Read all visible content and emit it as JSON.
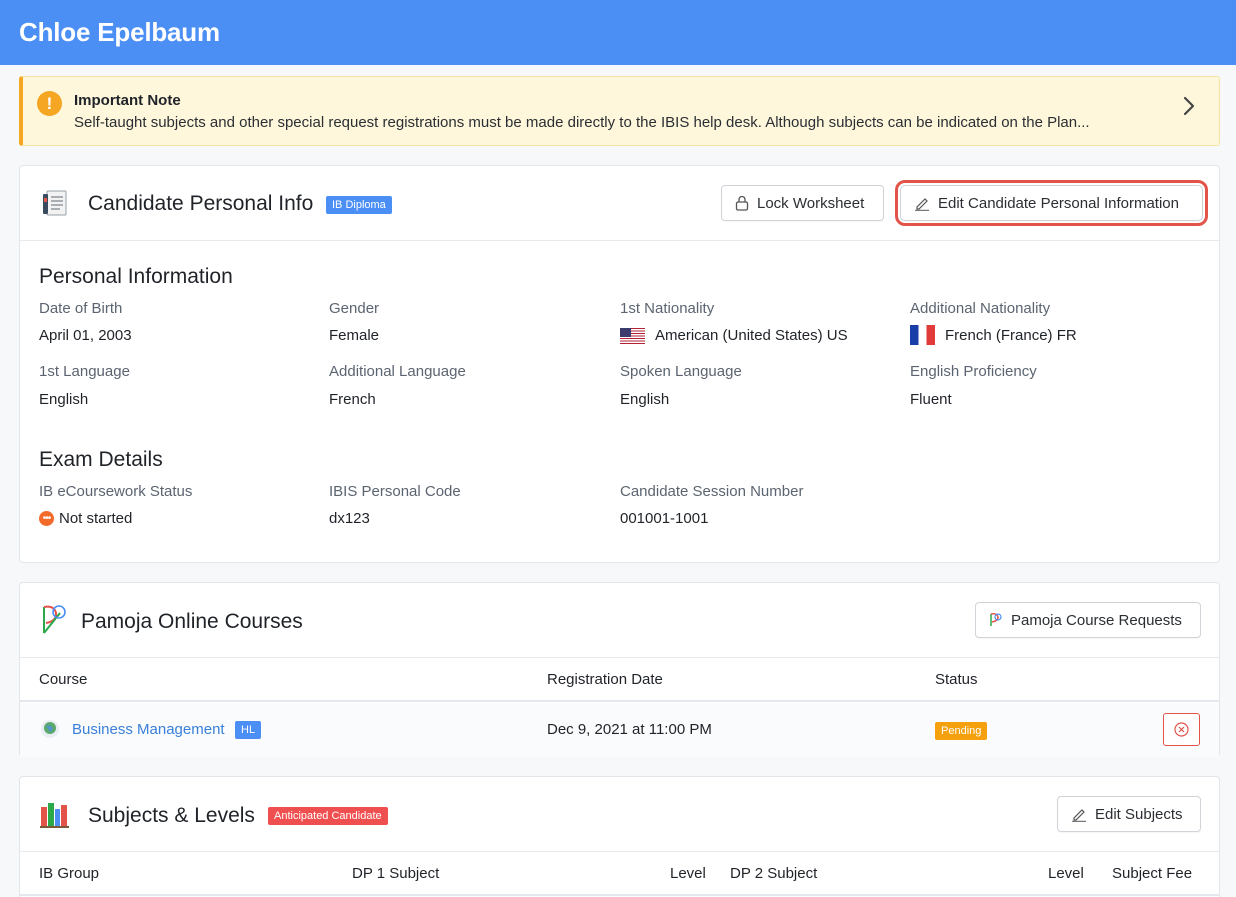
{
  "header": {
    "title": "Chloe Epelbaum"
  },
  "note": {
    "icon": "exclamation-icon",
    "icon_glyph": "!",
    "title": "Important Note",
    "body": "Self-taught subjects and other special request registrations must be made directly to the IBIS help desk. Although subjects can be indicated on the Plan..."
  },
  "personal_card": {
    "title": "Candidate Personal Info",
    "badge": "IB Diploma",
    "badge_color": "#4b8ff4",
    "lock_button": "Lock Worksheet",
    "edit_button": "Edit Candidate Personal Information",
    "personal_info": {
      "heading": "Personal Information",
      "date_of_birth": {
        "label": "Date of Birth",
        "value": "April 01, 2003"
      },
      "gender": {
        "label": "Gender",
        "value": "Female"
      },
      "first_nationality": {
        "label": "1st Nationality",
        "value": "American (United States) US",
        "flag": "us-flag-icon"
      },
      "additional_nationality": {
        "label": "Additional Nationality",
        "value": "French (France) FR",
        "flag": "fr-flag-icon"
      },
      "first_language": {
        "label": "1st Language",
        "value": "English"
      },
      "additional_language": {
        "label": "Additional Language",
        "value": "French"
      },
      "spoken_language": {
        "label": "Spoken Language",
        "value": "English"
      },
      "english_proficiency": {
        "label": "English Proficiency",
        "value": "Fluent"
      }
    },
    "exam_details": {
      "heading": "Exam Details",
      "ecoursework": {
        "label": "IB eCoursework Status",
        "value": "Not started",
        "dot_glyph": "•••"
      },
      "ibis_code": {
        "label": "IBIS Personal Code",
        "value": "dx123"
      },
      "session_number": {
        "label": "Candidate Session Number",
        "value": "001001-1001"
      }
    }
  },
  "pamoja_card": {
    "title": "Pamoja Online Courses",
    "requests_button": "Pamoja Course Requests",
    "columns": [
      "Course",
      "Registration Date",
      "Status"
    ],
    "rows": [
      {
        "course": "Business Management",
        "level": "HL",
        "date": "Dec 9, 2021 at 11:00 PM",
        "status": "Pending"
      }
    ],
    "colors": {
      "level_badge": "#4b8ff4",
      "status_pending": "#f5a00d",
      "remove": "#e2544a"
    }
  },
  "subjects_card": {
    "title": "Subjects & Levels",
    "badge": "Anticipated Candidate",
    "badge_color": "#ef4f4f",
    "edit_button": "Edit Subjects",
    "columns": [
      "IB Group",
      "DP 1 Subject",
      "Level",
      "DP 2 Subject",
      "Level",
      "Subject Fee"
    ]
  }
}
